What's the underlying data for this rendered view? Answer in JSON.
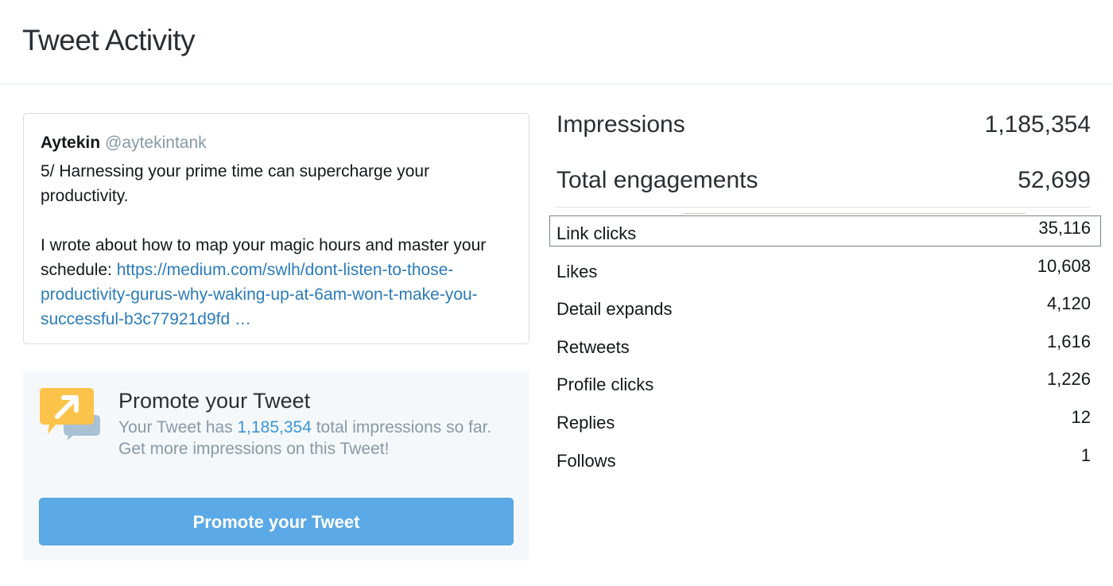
{
  "header": {
    "title": "Tweet Activity"
  },
  "tweet": {
    "name": "Aytekin",
    "handle": "@aytekintank",
    "paragraph1": "5/ Harnessing your prime time can supercharge your productivity.",
    "paragraph2_prefix": "I wrote about how to map your magic hours and master your schedule: ",
    "link": "https://medium.com/swlh/dont-listen-to-those-productivity-gurus-why-waking-up-at-6am-won-t-make-you-successful-b3c77921d9fd …"
  },
  "promo": {
    "title": "Promote your Tweet",
    "text_prefix": "Your Tweet has ",
    "impressions": "1,185,354",
    "text_suffix": " total impressions so far.",
    "cta_text": "Get more impressions on this Tweet!",
    "button_label": "Promote your Tweet",
    "icon": "promote-speech-bubble-icon"
  },
  "stats": {
    "impressions": {
      "label": "Impressions",
      "value": "1,185,354"
    },
    "total_engagements": {
      "label": "Total engagements",
      "value": "52,699"
    },
    "details": [
      {
        "label": "Link clicks",
        "value": "35,116"
      },
      {
        "label": "Likes",
        "value": "10,608"
      },
      {
        "label": "Detail expands",
        "value": "4,120"
      },
      {
        "label": "Retweets",
        "value": "1,616"
      },
      {
        "label": "Profile clicks",
        "value": "1,226"
      },
      {
        "label": "Replies",
        "value": "12"
      },
      {
        "label": "Follows",
        "value": "1"
      }
    ]
  },
  "colors": {
    "link": "#2b7bb9",
    "button": "#5ba9e6",
    "promo_bg": "#f5f8fa",
    "muted": "#8899a6",
    "icon_orange": "#fbc34a"
  }
}
